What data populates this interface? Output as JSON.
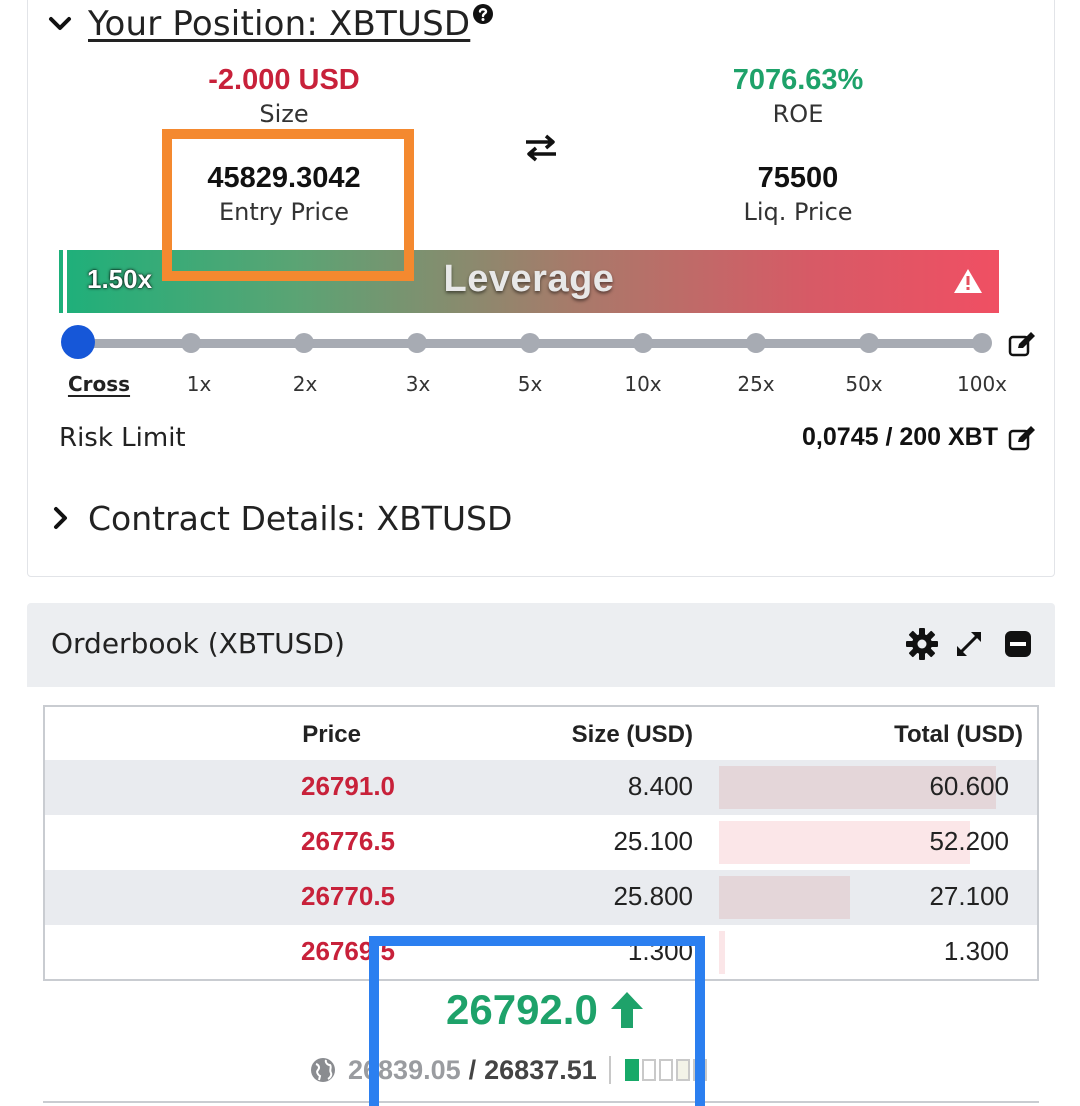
{
  "position": {
    "title": "Your Position: XBTUSD",
    "size_value": "-2.000 USD",
    "size_label": "Size",
    "roe_value": "7076.63%",
    "roe_label": "ROE",
    "entry_price_value": "45829.3042",
    "entry_price_label": "Entry Price",
    "liq_price_value": "75500",
    "liq_price_label": "Liq. Price"
  },
  "leverage": {
    "current": "1.50x",
    "label": "Leverage",
    "options": [
      "Cross",
      "1x",
      "2x",
      "3x",
      "5x",
      "10x",
      "25x",
      "50x",
      "100x"
    ],
    "selected": "Cross"
  },
  "risk_limit": {
    "label": "Risk Limit",
    "value": "0,0745 / 200 XBT"
  },
  "contract_details": {
    "title": "Contract Details: XBTUSD"
  },
  "orderbook": {
    "title": "Orderbook (XBTUSD)",
    "columns": [
      "Price",
      "Size (USD)",
      "Total (USD)"
    ],
    "rows": [
      {
        "price": "26791.0",
        "size": "8.400",
        "total": "60.600",
        "depth": 0.95
      },
      {
        "price": "26776.5",
        "size": "25.100",
        "total": "52.200",
        "depth": 0.86
      },
      {
        "price": "26770.5",
        "size": "25.800",
        "total": "27.100",
        "depth": 0.45
      },
      {
        "price": "26769.5",
        "size": "1.300",
        "total": "1.300",
        "depth": 0.02
      }
    ],
    "last_price": "26792.0",
    "last_direction": "up",
    "index_price": "26839.05",
    "mark_price": "26837.51",
    "separator": "/"
  },
  "colors": {
    "negative": "#c8213a",
    "positive": "#1ea26a",
    "slider_knob": "#1657d8",
    "highlight_orange": "#f4892f",
    "highlight_blue": "#2b7ff0"
  },
  "icons": [
    "chevron-down-icon",
    "help-icon",
    "swap-arrows-icon",
    "warning-icon",
    "edit-icon",
    "chevron-right-icon",
    "gear-icon",
    "expand-icon",
    "minimize-icon",
    "arrow-up-icon",
    "globe-icon"
  ]
}
